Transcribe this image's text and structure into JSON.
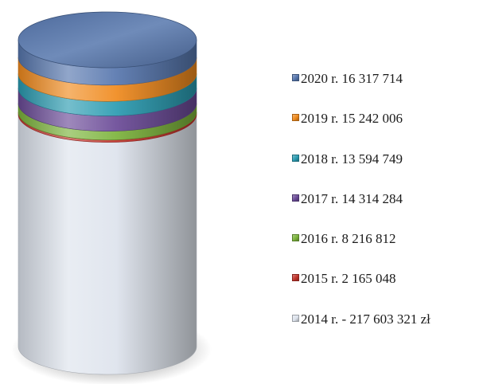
{
  "chart_data": {
    "type": "stacked-cylinder",
    "title": "",
    "unit": "zł",
    "series": [
      {
        "name": "2014 r.",
        "value": 217603321,
        "label": "2014 r. - 217 603 321 zł",
        "color": "#dde3ec"
      },
      {
        "name": "2015 r.",
        "value": 2165048,
        "label": "2015 r. 2 165 048",
        "color": "#c0332b"
      },
      {
        "name": "2016 r.",
        "value": 8216812,
        "label": "2016 r. 8 216 812",
        "color": "#7bb33b"
      },
      {
        "name": "2017 r.",
        "value": 14314284,
        "label": "2017 r. 14 314 284",
        "color": "#6a4a97"
      },
      {
        "name": "2018 r.",
        "value": 13594749,
        "label": "2018 r. 13 594 749",
        "color": "#2a9bb1"
      },
      {
        "name": "2019 r.",
        "value": 15242006,
        "label": "2019 r. 15 242 006",
        "color": "#f08a1d"
      },
      {
        "name": "2020 r.",
        "value": 16317714,
        "label": "2020 r. 16 317 714",
        "color": "#5676ad"
      }
    ],
    "legend_order": [
      "2020 r.",
      "2019 r.",
      "2018 r.",
      "2017 r.",
      "2016 r.",
      "2015 r.",
      "2014 r."
    ],
    "legend_position": "right"
  }
}
